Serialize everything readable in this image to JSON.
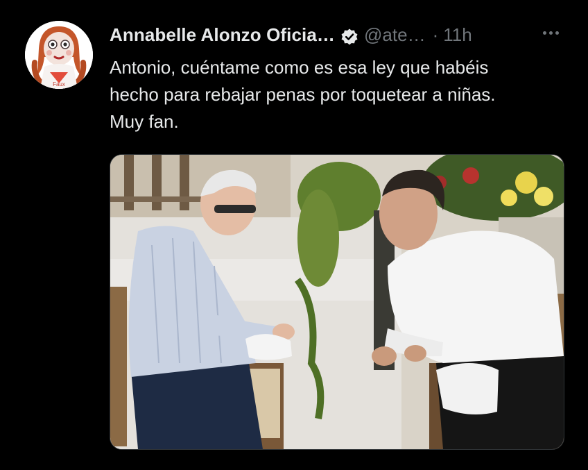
{
  "tweet": {
    "author_name": "Annabelle Alonzo Oficia…",
    "handle": "@ate…",
    "separator": "·",
    "time": "11h",
    "avatar_caption": "Faux",
    "text_lines": [
      "Antonio, cuéntame como es esa ley que habéis",
      "hecho para rebajar penas por toquetear a niñas.",
      "Muy fan."
    ]
  },
  "icons": {
    "verified": "verified-badge-icon",
    "more": "more-horizontal-icon"
  },
  "colors": {
    "background": "#000000",
    "primary_text": "#e7e9ea",
    "secondary_text": "#71767b",
    "media_border": "#2f3336"
  }
}
